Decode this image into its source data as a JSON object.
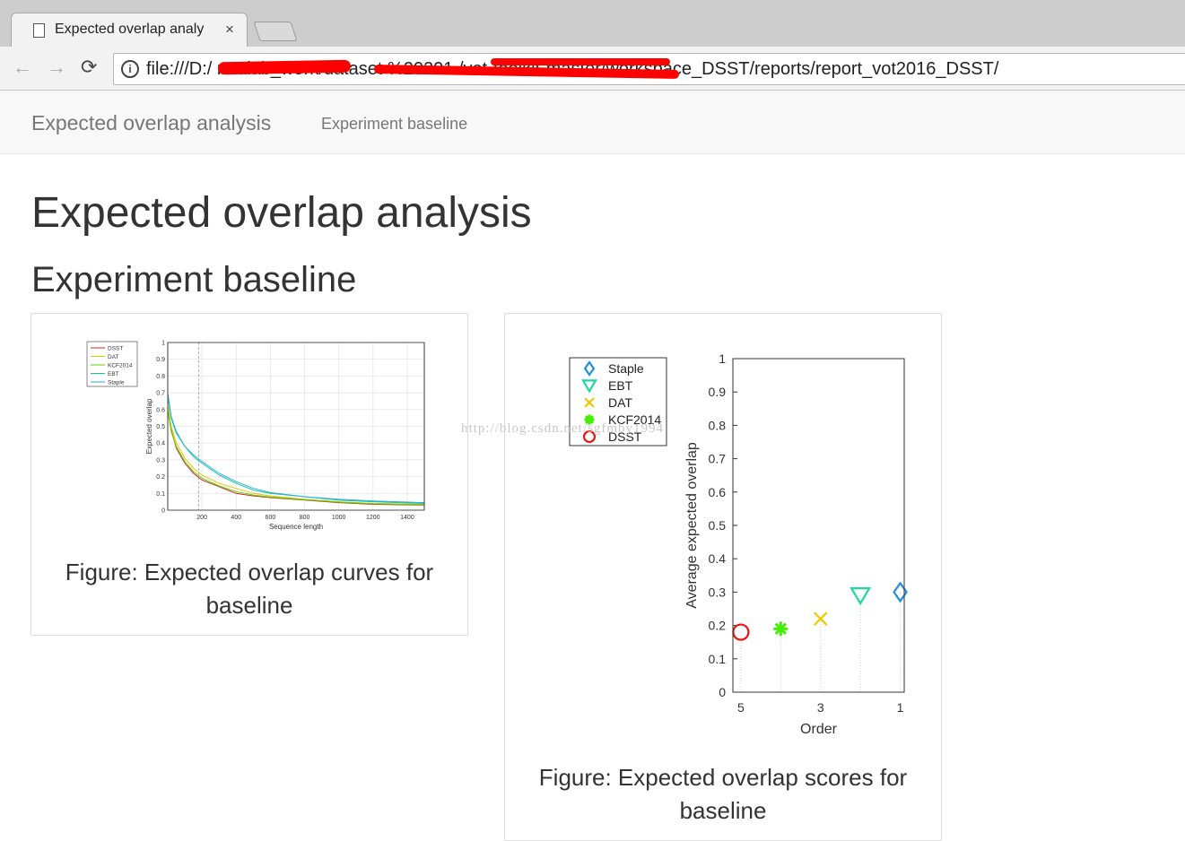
{
  "browser": {
    "tab_title": "Expected overlap analy",
    "tab_close": "×",
    "back_glyph": "←",
    "forward_glyph": "→",
    "reload_glyph": "⟳",
    "info_glyph": "i",
    "url": "file:///D:/                                  matlab_work/dataset          %20201 /vot-toolkit-master/workspace_DSST/reports/report_vot2016_DSST/"
  },
  "navbar": {
    "brand": "Expected overlap analysis",
    "link": "Experiment baseline"
  },
  "page": {
    "title": "Expected overlap analysis",
    "subtitle": "Experiment baseline"
  },
  "figures": {
    "curves_caption_line1": "Figure: Expected overlap curves for",
    "curves_caption_line2": "baseline",
    "scores_caption_line1": "Figure: Expected overlap scores for",
    "scores_caption_line2": "baseline",
    "watermark": "http://blog.csdn.net/sgfmby1994"
  },
  "chart_data": [
    {
      "type": "line",
      "xlabel": "Sequence length",
      "ylabel": "Expected overlap",
      "xlim": [
        0,
        1500
      ],
      "ylim": [
        0,
        1
      ],
      "xticks": [
        200,
        400,
        600,
        800,
        1000,
        1200,
        1400
      ],
      "yticks": [
        0,
        0.1,
        0.2,
        0.3,
        0.4,
        0.5,
        0.6,
        0.7,
        0.8,
        0.9,
        1
      ],
      "grid": true,
      "legend_position": "outside-top-left",
      "marker_line_x": 180,
      "series": [
        {
          "name": "DSST",
          "color": "#d62728",
          "x": [
            0,
            20,
            50,
            100,
            150,
            200,
            300,
            400,
            500,
            600,
            800,
            1000,
            1200,
            1500
          ],
          "values": [
            0.62,
            0.48,
            0.37,
            0.28,
            0.22,
            0.18,
            0.14,
            0.1,
            0.085,
            0.075,
            0.06,
            0.045,
            0.035,
            0.03
          ]
        },
        {
          "name": "DAT",
          "color": "#e8c400",
          "x": [
            0,
            20,
            50,
            100,
            150,
            200,
            300,
            400,
            500,
            600,
            800,
            1000,
            1200,
            1500
          ],
          "values": [
            0.63,
            0.5,
            0.4,
            0.31,
            0.25,
            0.21,
            0.16,
            0.13,
            0.1,
            0.085,
            0.065,
            0.05,
            0.04,
            0.035
          ]
        },
        {
          "name": "KCF2014",
          "color": "#55d400",
          "x": [
            0,
            20,
            50,
            100,
            150,
            200,
            300,
            400,
            500,
            600,
            800,
            1000,
            1200,
            1500
          ],
          "values": [
            0.6,
            0.47,
            0.38,
            0.29,
            0.23,
            0.19,
            0.145,
            0.11,
            0.09,
            0.078,
            0.062,
            0.048,
            0.038,
            0.032
          ]
        },
        {
          "name": "EBT",
          "color": "#00cc99",
          "x": [
            0,
            20,
            50,
            100,
            150,
            200,
            300,
            400,
            500,
            600,
            800,
            1000,
            1200,
            1500
          ],
          "values": [
            0.68,
            0.55,
            0.46,
            0.38,
            0.32,
            0.28,
            0.21,
            0.16,
            0.12,
            0.1,
            0.08,
            0.06,
            0.05,
            0.04
          ]
        },
        {
          "name": "Staple",
          "color": "#33aadd",
          "x": [
            0,
            20,
            50,
            100,
            150,
            200,
            300,
            400,
            500,
            600,
            800,
            1000,
            1200,
            1500
          ],
          "values": [
            0.7,
            0.56,
            0.47,
            0.38,
            0.33,
            0.29,
            0.22,
            0.17,
            0.13,
            0.105,
            0.08,
            0.065,
            0.055,
            0.045
          ]
        }
      ]
    },
    {
      "type": "scatter",
      "xlabel": "Order",
      "ylabel": "Average expected overlap",
      "xlim": [
        5.2,
        0.9
      ],
      "ylim": [
        0,
        1
      ],
      "xticks": [
        5,
        3,
        1
      ],
      "yticks": [
        0,
        0.1,
        0.2,
        0.3,
        0.4,
        0.5,
        0.6,
        0.7,
        0.8,
        0.9,
        1
      ],
      "legend_position": "outside-top-left",
      "series": [
        {
          "name": "Staple",
          "marker": "diamond",
          "color": "#1f8fe0",
          "x": 1,
          "y": 0.3
        },
        {
          "name": "EBT",
          "marker": "triangle-down",
          "color": "#1fd8a0",
          "x": 2,
          "y": 0.29
        },
        {
          "name": "DAT",
          "marker": "x",
          "color": "#f0c800",
          "x": 3,
          "y": 0.22
        },
        {
          "name": "KCF2014",
          "marker": "asterisk",
          "color": "#44ee00",
          "x": 4,
          "y": 0.19
        },
        {
          "name": "DSST",
          "marker": "circle",
          "color": "#ee1111",
          "x": 5,
          "y": 0.18
        }
      ]
    }
  ]
}
